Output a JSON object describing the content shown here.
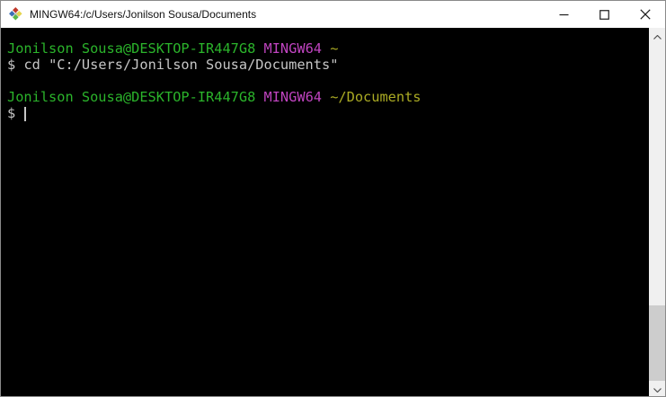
{
  "titlebar": {
    "title": "MINGW64:/c/Users/Jonilson Sousa/Documents",
    "icons": {
      "app": "mintty-diamond-icon",
      "minimize": "minimize-icon",
      "maximize": "maximize-icon",
      "close": "close-icon"
    }
  },
  "terminal": {
    "prompt_line_1": {
      "user_host": "Jonilson Sousa@DESKTOP-IR447G8",
      "environment": "MINGW64",
      "path": "~"
    },
    "command_1": "cd \"C:/Users/Jonilson Sousa/Documents\"",
    "prompt_line_2": {
      "user_host": "Jonilson Sousa@DESKTOP-IR447G8",
      "environment": "MINGW64",
      "path": "~/Documents"
    },
    "prompt_symbol": "$"
  },
  "scrollbar": {
    "up_icon": "chevron-up-icon",
    "down_icon": "chevron-down-icon"
  },
  "colors": {
    "ansi-green": "#2bb42b",
    "ansi-magenta": "#c044c0",
    "ansi-yellow": "#abab24",
    "terminal-fg": "#c6c6c6",
    "terminal-bg": "#000000",
    "titlebar-bg": "#ffffff"
  }
}
